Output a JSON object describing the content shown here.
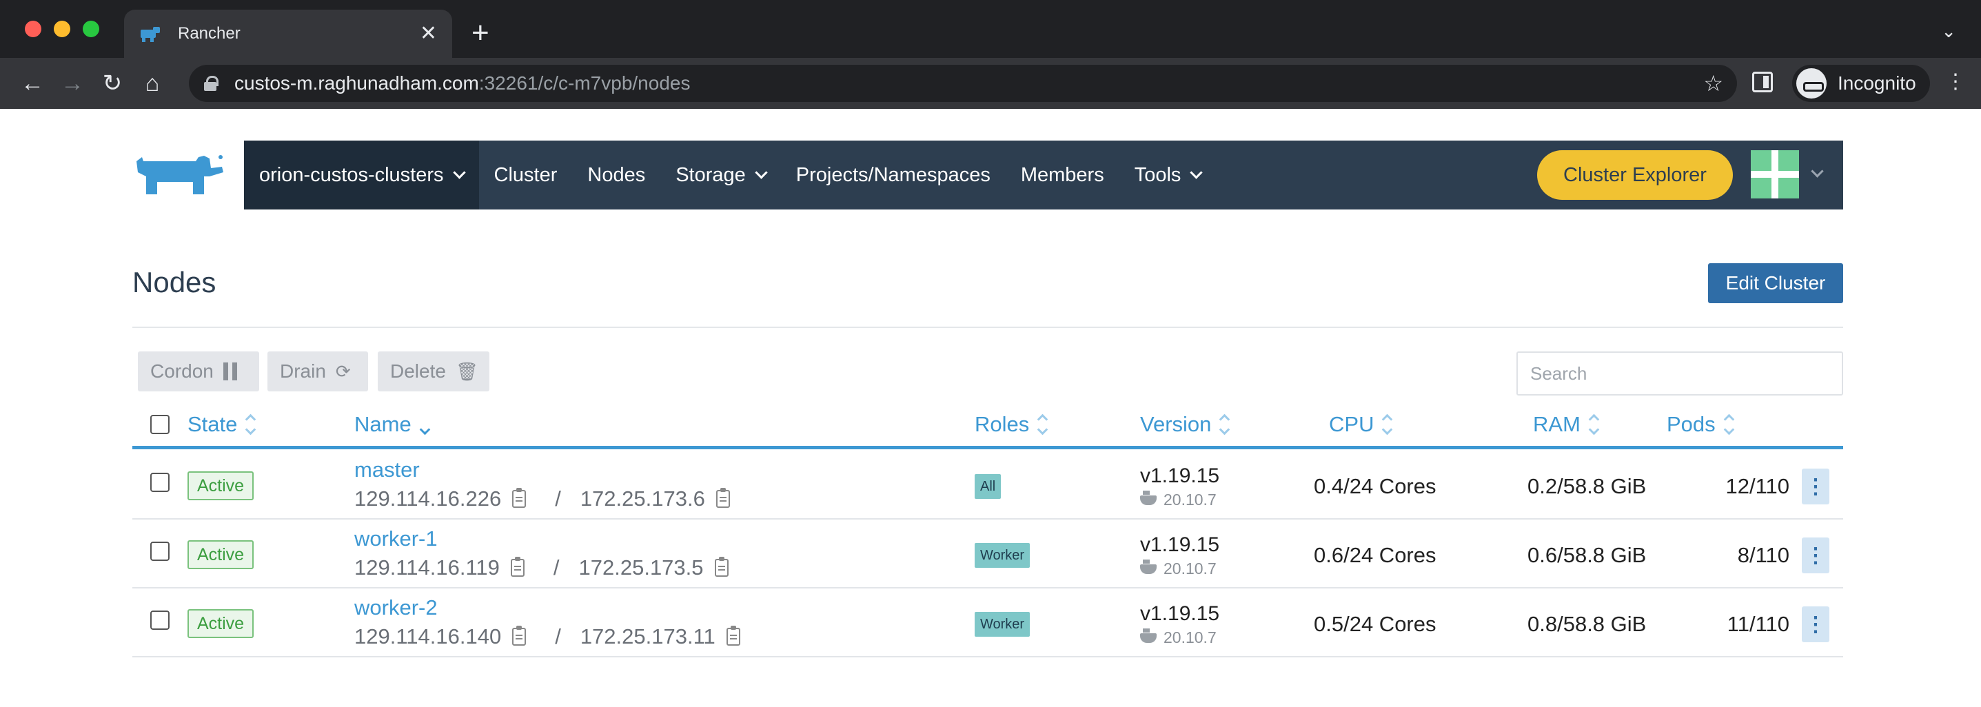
{
  "browser": {
    "tab_title": "Rancher",
    "url_host": "custos-m.raghunadham.com",
    "url_path": ":32261/c/c-m7vpb/nodes",
    "profile_label": "Incognito"
  },
  "rancher_nav": {
    "cluster": "orion-custos-clusters",
    "items": [
      "Cluster",
      "Nodes",
      "Storage",
      "Projects/Namespaces",
      "Members",
      "Tools"
    ],
    "explorer_button": "Cluster Explorer",
    "colors": {
      "nav_bg": "#2d3e50",
      "accent": "#f1c232"
    }
  },
  "page": {
    "title": "Nodes",
    "edit_button": "Edit Cluster"
  },
  "bulk_actions": {
    "cordon": "Cordon",
    "drain": "Drain",
    "delete": "Delete"
  },
  "search": {
    "placeholder": "Search",
    "value": ""
  },
  "table": {
    "headers": {
      "state": "State",
      "name": "Name",
      "roles": "Roles",
      "version": "Version",
      "cpu": "CPU",
      "ram": "RAM",
      "pods": "Pods"
    },
    "sorted_by": "Name",
    "rows": [
      {
        "state": "Active",
        "name": "master",
        "public_ip": "129.114.16.226",
        "separator": "/",
        "private_ip": "172.25.173.6",
        "role": "All",
        "version": "v1.19.15",
        "docker": "20.10.7",
        "cpu": "0.4/24 Cores",
        "ram": "0.2/58.8 GiB",
        "pods": "12/110"
      },
      {
        "state": "Active",
        "name": "worker-1",
        "public_ip": "129.114.16.119",
        "separator": "/",
        "private_ip": "172.25.173.5",
        "role": "Worker",
        "version": "v1.19.15",
        "docker": "20.10.7",
        "cpu": "0.6/24 Cores",
        "ram": "0.6/58.8 GiB",
        "pods": "8/110"
      },
      {
        "state": "Active",
        "name": "worker-2",
        "public_ip": "129.114.16.140",
        "separator": "/",
        "private_ip": "172.25.173.11",
        "role": "Worker",
        "version": "v1.19.15",
        "docker": "20.10.7",
        "cpu": "0.5/24 Cores",
        "ram": "0.8/58.8 GiB",
        "pods": "11/110"
      }
    ]
  }
}
